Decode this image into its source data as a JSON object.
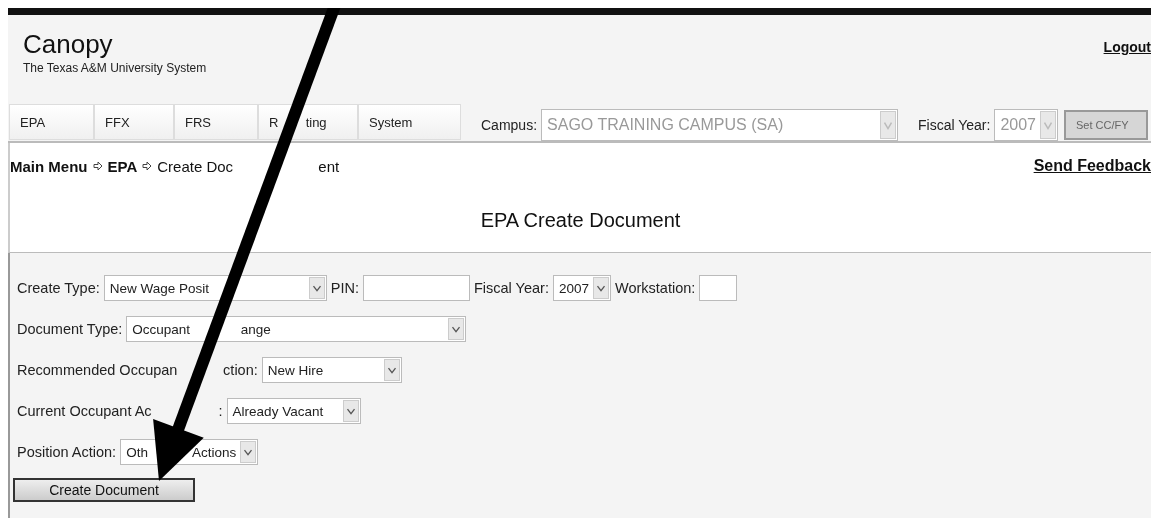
{
  "header": {
    "title": "Canopy",
    "subtitle": "The Texas A&M University System",
    "logout": "Logout"
  },
  "tabs": [
    {
      "label_parts": [
        "EPA"
      ]
    },
    {
      "label_parts": [
        "FFX"
      ]
    },
    {
      "label_parts": [
        "FRS"
      ]
    },
    {
      "label_parts": [
        "R",
        "ting"
      ]
    },
    {
      "label_parts": [
        "System"
      ]
    }
  ],
  "context": [
    {
      "kind": "select",
      "label_parts": [
        "Campus:"
      ],
      "value_parts": [
        "SAGO TRAINING CAMPUS (SA)"
      ],
      "disabled": true
    },
    {
      "kind": "select",
      "label_parts": [
        "Fiscal Year:"
      ],
      "value_parts": [
        "2007"
      ],
      "disabled": true
    },
    {
      "kind": "button",
      "value": "Set CC/FY",
      "disabled": true
    }
  ],
  "breadcrumb": [
    {
      "label_parts": [
        "Main Menu"
      ],
      "bold": true
    },
    {
      "label_parts": [
        "EPA"
      ],
      "bold": true
    },
    {
      "label_parts": [
        "Create Doc",
        "ent"
      ],
      "bold": false
    }
  ],
  "feedback": "Send Feedback",
  "page_title": "EPA Create Document",
  "form_rows": [
    [
      {
        "kind": "select",
        "label_parts": [
          "Create Type:"
        ],
        "value_parts": [
          "New Wage Posit"
        ]
      },
      {
        "kind": "input",
        "label_parts": [
          "PIN:"
        ]
      },
      {
        "kind": "select",
        "label_parts": [
          "Fiscal Year:"
        ],
        "value_parts": [
          "2007"
        ]
      },
      {
        "kind": "input",
        "label_parts": [
          "Workstation:"
        ]
      }
    ],
    [
      {
        "kind": "select",
        "label_parts": [
          "Document Type:"
        ],
        "value_parts": [
          "Occupant",
          "ange"
        ]
      }
    ],
    [
      {
        "kind": "select",
        "label_parts": [
          "Recommended Occupan",
          "ction:"
        ],
        "value_parts": [
          "New Hire"
        ]
      }
    ],
    [
      {
        "kind": "select",
        "label_parts": [
          "Current Occupant Ac",
          ":"
        ],
        "value_parts": [
          "Already Vacant"
        ]
      }
    ],
    [
      {
        "kind": "select",
        "label_parts": [
          "Position Action:"
        ],
        "value_parts": [
          "Oth",
          "Actions"
        ]
      }
    ]
  ],
  "submit": "Create Document"
}
